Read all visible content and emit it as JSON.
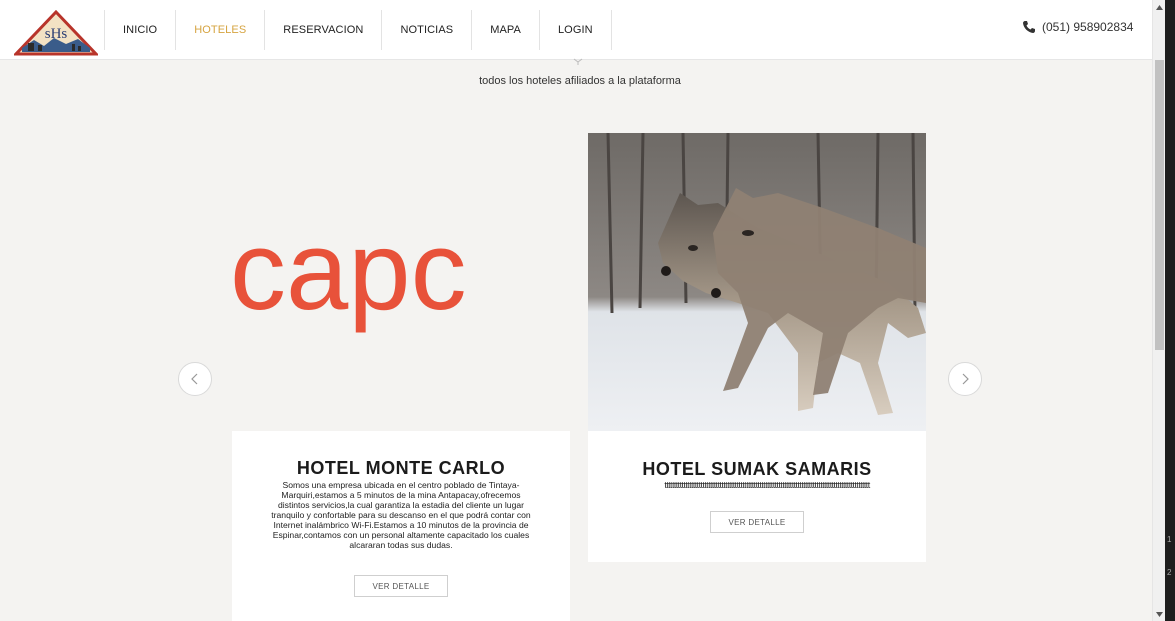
{
  "header": {
    "logo_text": "sHs",
    "nav": [
      {
        "label": "INICIO",
        "active": false
      },
      {
        "label": "HOTELES",
        "active": true
      },
      {
        "label": "RESERVACION",
        "active": false
      },
      {
        "label": "NOTICIAS",
        "active": false
      },
      {
        "label": "MAPA",
        "active": false
      },
      {
        "label": "LOGIN",
        "active": false
      }
    ],
    "phone": "(051) 958902834",
    "phone_icon": "phone-icon",
    "accent_color": "#d6a441"
  },
  "main": {
    "subtitle": "todos los hoteles afiliados a la plataforma",
    "cards": [
      {
        "image_text": "capc",
        "image_text_color": "#e8523a",
        "title": "HOTEL MONTE CARLO",
        "description_lines": [
          "Somos una empresa ubicada en el centro poblado de Tintaya-",
          "Marquiri,estamos a 5 minutos de la mina Antapacay,ofrecemos",
          "distintos servicios,la cual garantiza la estadia del cliente un lugar",
          "tranquilo y confortable para su descanso en el que podrá contar con",
          "Internet inalámbrico Wi-Fi.Estamos a 10 minutos de la provincia de",
          "Espinar,contamos con un personal altamente capacitado los cuales",
          "alcararan todas sus dudas."
        ],
        "button": "VER DETALLE"
      },
      {
        "image_alt": "wolves",
        "title": "HOTEL SUMAK SAMARIS",
        "description": "tttttttttttttttttttttttttttttttttttttttttttttttttttttttttttttttttttttttttttttttttttttttttttttttttttttttttttt",
        "button": "VER DETALLE"
      }
    ],
    "prev_icon": "chevron-left-icon",
    "next_icon": "chevron-right-icon"
  },
  "edge": {
    "lines": [
      "1",
      "2"
    ]
  }
}
